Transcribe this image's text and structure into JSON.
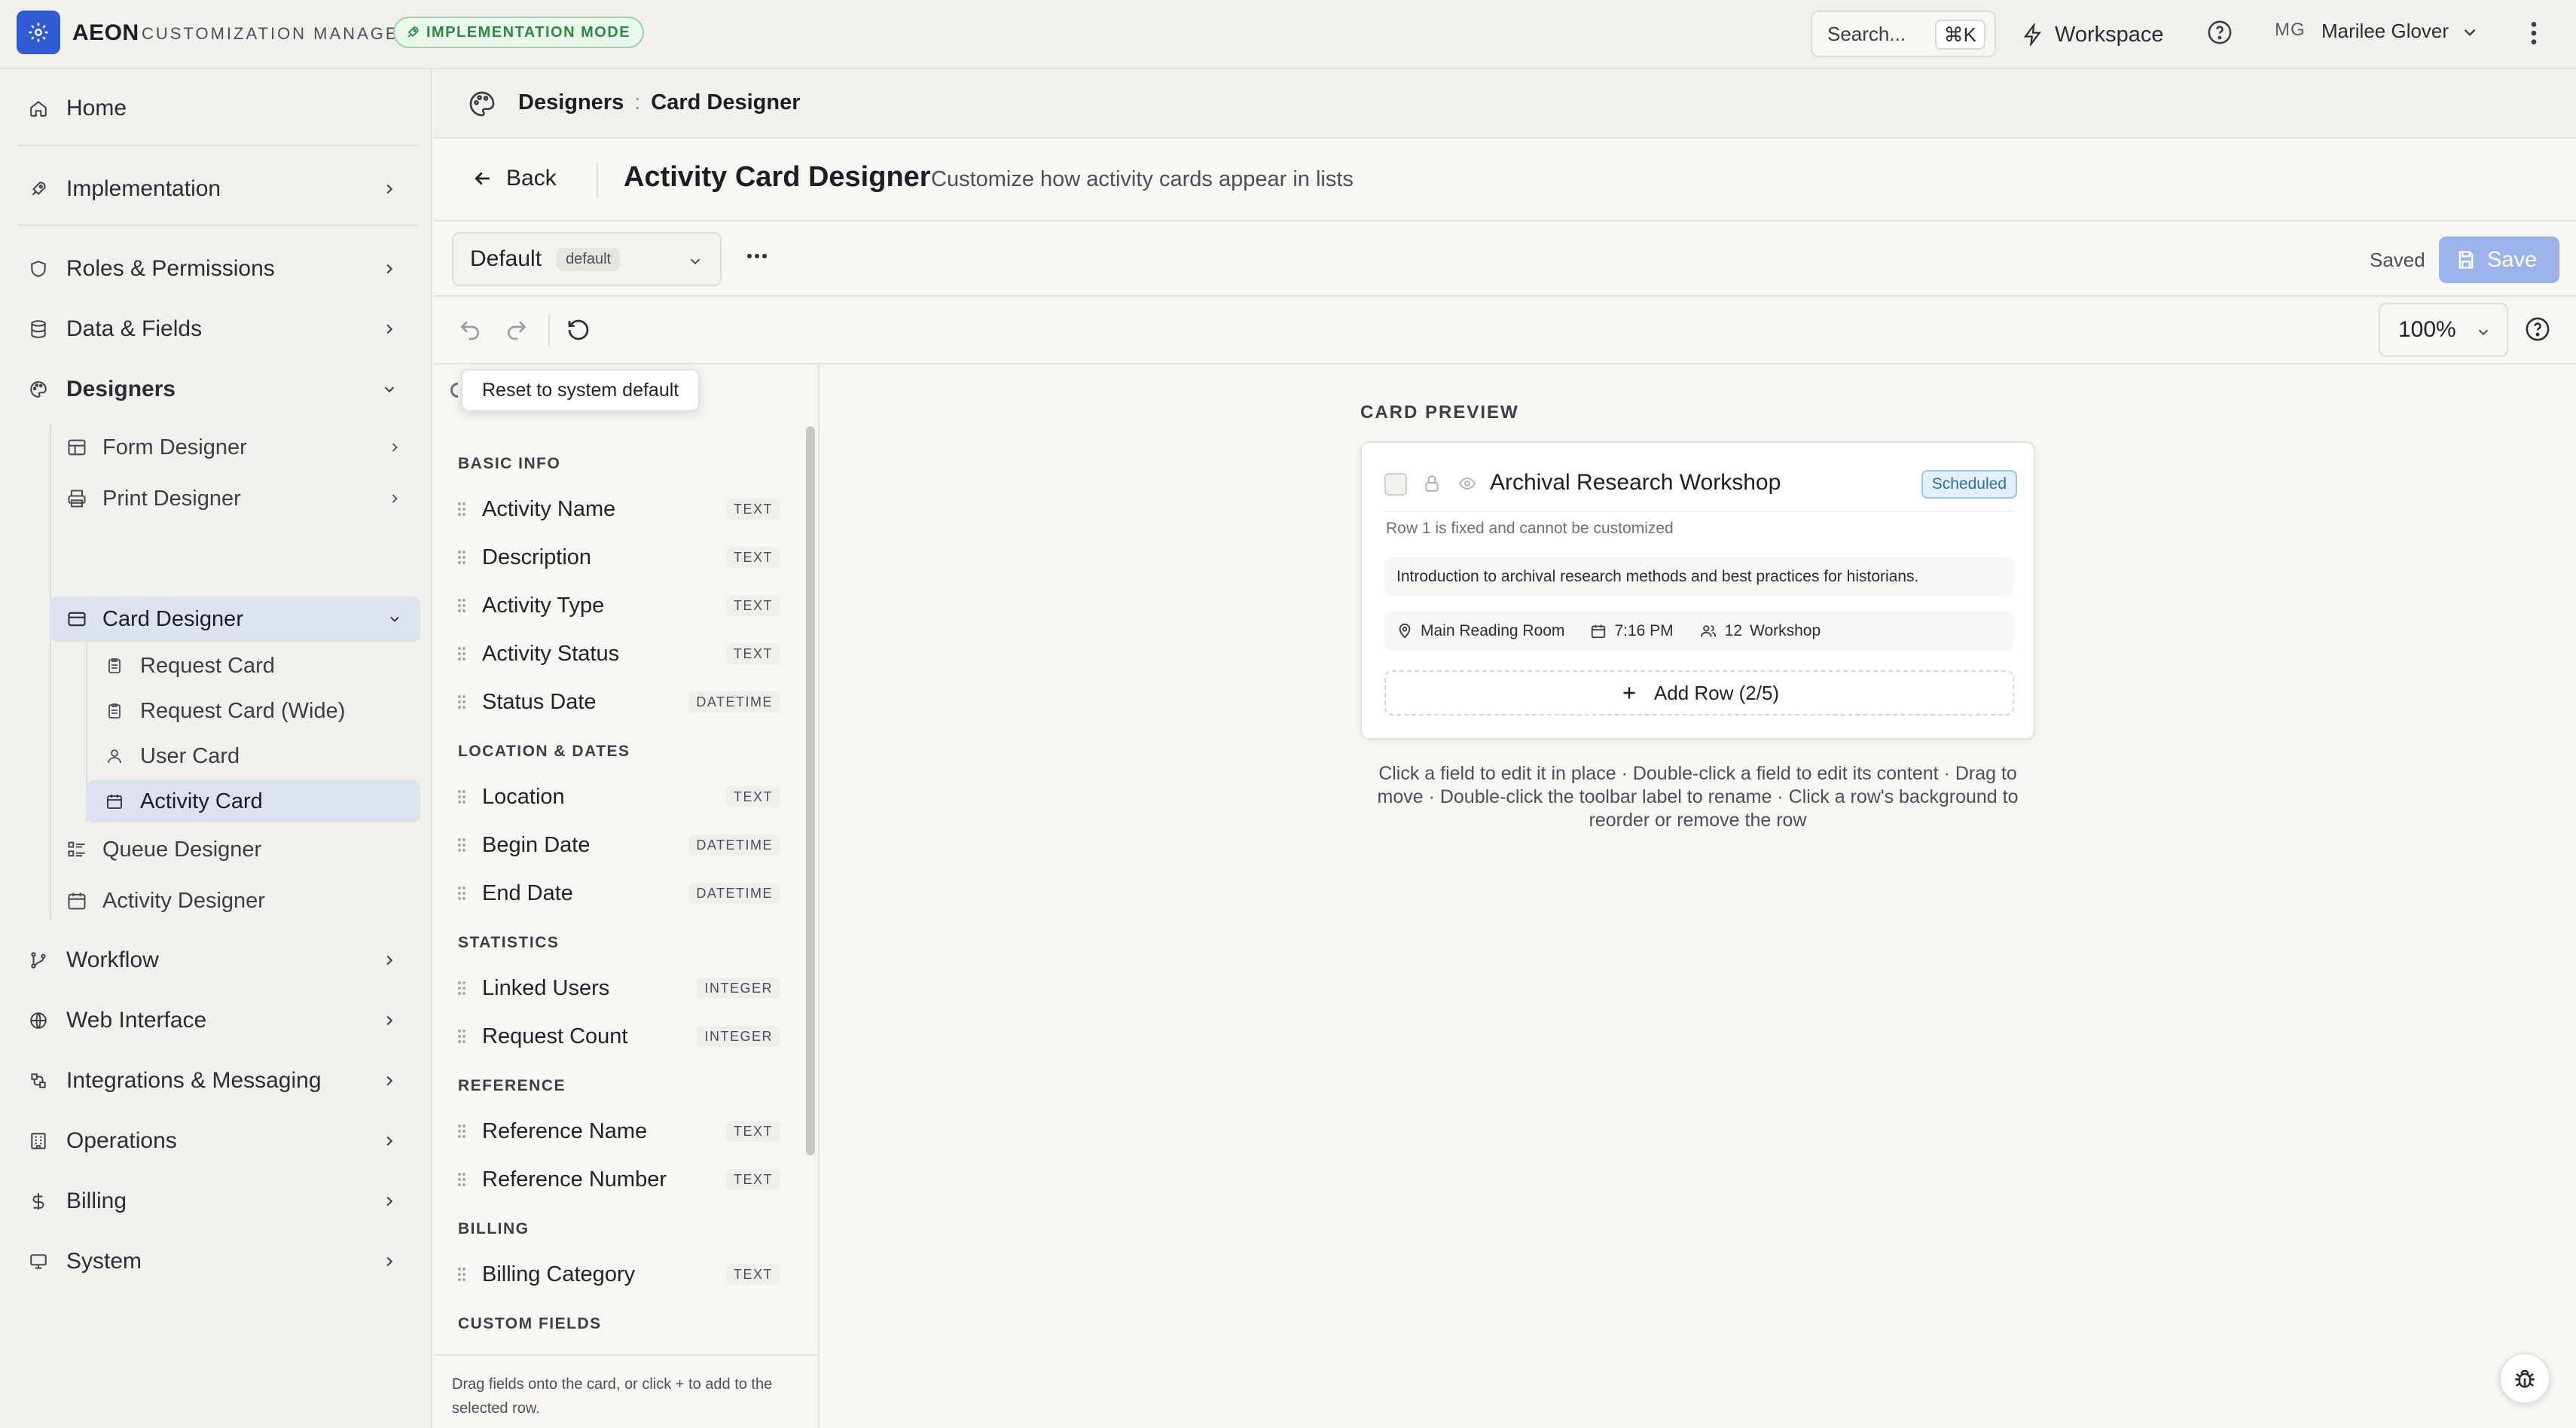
{
  "app": {
    "brand": "AEON",
    "subtitle": "CUSTOMIZATION MANAGER",
    "mode_badge": "IMPLEMENTATION MODE",
    "search_placeholder": "Search...",
    "search_shortcut": "⌘K",
    "workspace_label": "Workspace",
    "user_initials": "MG",
    "user_name": "Marilee Glover"
  },
  "sidebar": {
    "items": [
      {
        "label": "Home",
        "icon": "home-icon"
      },
      {
        "label": "Implementation",
        "icon": "rocket-icon"
      },
      {
        "label": "Roles & Permissions",
        "icon": "shield-icon"
      },
      {
        "label": "Data & Fields",
        "icon": "database-icon"
      },
      {
        "label": "Designers",
        "icon": "palette-icon"
      },
      {
        "label": "Workflow",
        "icon": "workflow-icon"
      },
      {
        "label": "Web Interface",
        "icon": "globe-icon"
      },
      {
        "label": "Integrations & Messaging",
        "icon": "integrations-icon"
      },
      {
        "label": "Operations",
        "icon": "building-icon"
      },
      {
        "label": "Billing",
        "icon": "dollar-icon"
      },
      {
        "label": "System",
        "icon": "monitor-icon"
      }
    ],
    "designers": [
      {
        "label": "Form Designer"
      },
      {
        "label": "Print Designer"
      },
      {
        "label": "Card Designer"
      },
      {
        "label": "Queue Designer"
      },
      {
        "label": "Activity Designer"
      }
    ],
    "cards": [
      {
        "label": "Request Card"
      },
      {
        "label": "Request Card (Wide)"
      },
      {
        "label": "User Card"
      },
      {
        "label": "Activity Card"
      }
    ]
  },
  "breadcrumb": {
    "parent": "Designers",
    "separator": ":",
    "current": "Card Designer"
  },
  "header": {
    "back_label": "Back",
    "title": "Activity Card Designer",
    "subtitle": "Customize how activity cards appear in lists"
  },
  "layout_bar": {
    "selected_layout": "Default",
    "layout_tag": "default",
    "saved_status": "Saved",
    "save_label": "Save"
  },
  "toolbar": {
    "zoom": "100%",
    "tooltip": "Reset to system default"
  },
  "palette": {
    "groups": [
      {
        "title": "BASIC INFO",
        "fields": [
          {
            "name": "Activity Name",
            "type": "TEXT"
          },
          {
            "name": "Description",
            "type": "TEXT"
          },
          {
            "name": "Activity Type",
            "type": "TEXT"
          },
          {
            "name": "Activity Status",
            "type": "TEXT"
          },
          {
            "name": "Status Date",
            "type": "DATETIME"
          }
        ]
      },
      {
        "title": "LOCATION & DATES",
        "fields": [
          {
            "name": "Location",
            "type": "TEXT"
          },
          {
            "name": "Begin Date",
            "type": "DATETIME"
          },
          {
            "name": "End Date",
            "type": "DATETIME"
          }
        ]
      },
      {
        "title": "STATISTICS",
        "fields": [
          {
            "name": "Linked Users",
            "type": "INTEGER"
          },
          {
            "name": "Request Count",
            "type": "INTEGER"
          }
        ]
      },
      {
        "title": "REFERENCE",
        "fields": [
          {
            "name": "Reference Name",
            "type": "TEXT"
          },
          {
            "name": "Reference Number",
            "type": "TEXT"
          }
        ]
      },
      {
        "title": "BILLING",
        "fields": [
          {
            "name": "Billing Category",
            "type": "TEXT"
          }
        ]
      },
      {
        "title": "CUSTOM FIELDS",
        "fields": []
      }
    ],
    "footer_hint": "Drag fields onto the card, or click + to add to the selected row."
  },
  "preview": {
    "label": "CARD PREVIEW",
    "card_title": "Archival Research Workshop",
    "status": "Scheduled",
    "fixed_note": "Row 1 is fixed and cannot be customized",
    "description": "Introduction to archival research methods and best practices for historians.",
    "location": "Main Reading Room",
    "time": "7:16 PM",
    "linked_users": "12",
    "activity_type": "Workshop",
    "add_row_label": "Add Row (2/5)",
    "hint": "Click a field to edit it in place · Double-click a field to edit its content · Drag to move · Double-click the toolbar label to rename · Click a row's background to reorder or remove the row"
  },
  "colors": {
    "accent": "#2f5bd3",
    "save_disabled": "#9cb3ea",
    "mode_badge": "#2d8a44",
    "status_badge": "#2d6fa3",
    "active_nav": "#dde3ee"
  }
}
